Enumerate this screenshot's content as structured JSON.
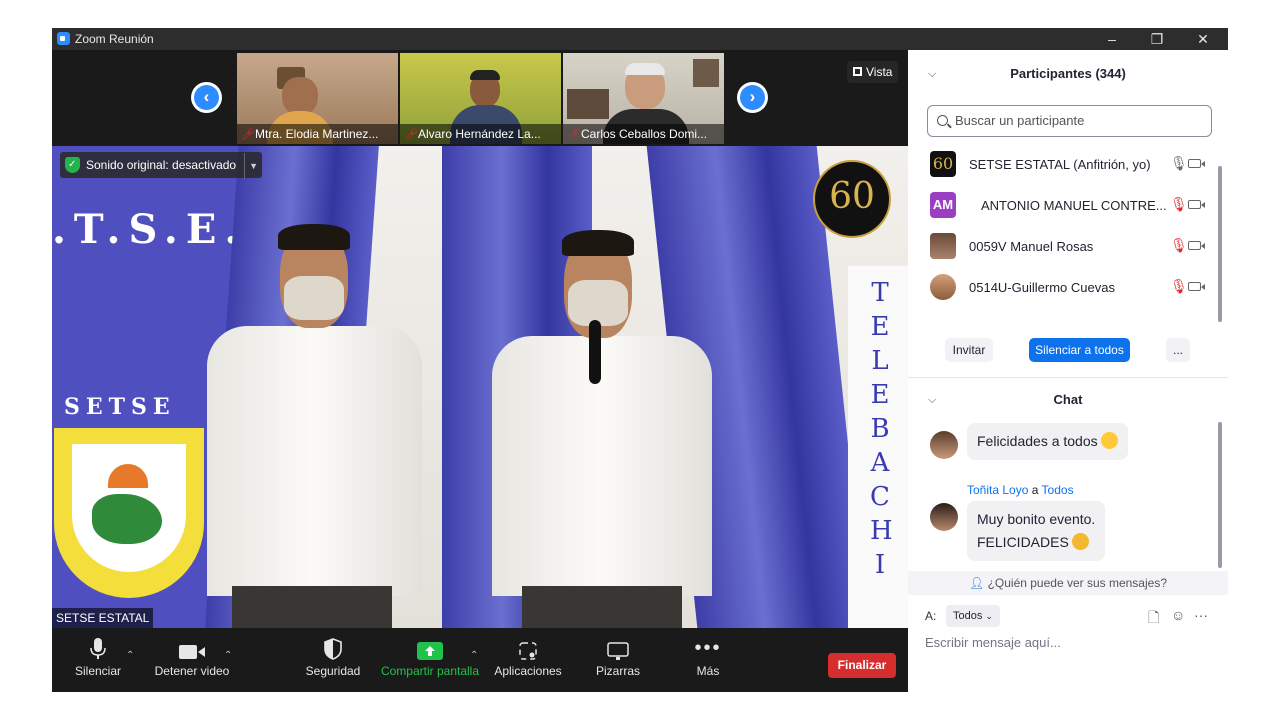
{
  "window": {
    "title": "Zoom Reunión"
  },
  "thumbnails": [
    {
      "name": "Mtra. Elodia Martinez..."
    },
    {
      "name": "Alvaro Hernández La..."
    },
    {
      "name": "Carlos Ceballos Domi..."
    }
  ],
  "vista_label": "Vista",
  "main_video": {
    "sound_status": "Sonido original: desactivado",
    "speaker": "SETSE ESTATAL",
    "anniversary": "60",
    "banner_text": ".T.S.E.",
    "emblem_word": "SETSE",
    "vertical_sign": [
      "T",
      "E",
      "L",
      "E",
      "B",
      "A",
      "C",
      "H",
      "I"
    ]
  },
  "toolbar": {
    "mute": "Silenciar",
    "video": "Detener video",
    "security": "Seguridad",
    "share": "Compartir pantalla",
    "apps": "Aplicaciones",
    "whiteboards": "Pizarras",
    "more": "Más",
    "end": "Finalizar"
  },
  "participants": {
    "title": "Participantes (344)",
    "search_placeholder": "Buscar un participante",
    "list": [
      {
        "name": "SETSE ESTATAL (Anfitrión, yo)",
        "avatar": "60",
        "muted": false
      },
      {
        "name": "ANTONIO MANUEL CONTRE...",
        "avatar": "AM",
        "muted": true
      },
      {
        "name": "0059V Manuel Rosas",
        "avatar": "",
        "muted": true
      },
      {
        "name": "0514U-Guillermo Cuevas",
        "avatar": "",
        "muted": true
      }
    ],
    "invite": "Invitar",
    "mute_all": "Silenciar a todos",
    "more": "...",
    "colors": {
      "accent": "#0e72ed",
      "muted": "#e02828"
    }
  },
  "chat": {
    "title": "Chat",
    "messages": [
      {
        "text": "Felicidades a todos"
      },
      {
        "sender": "Toñita Loyo",
        "connector": "a",
        "recipient": "Todos",
        "lines": [
          "Muy bonito evento.",
          "FELICIDADES"
        ]
      }
    ],
    "who_can_see": "¿Quién puede ver sus mensajes?",
    "to_label": "A:",
    "to_value": "Todos",
    "input_placeholder": "Escribir mensaje aquí..."
  }
}
